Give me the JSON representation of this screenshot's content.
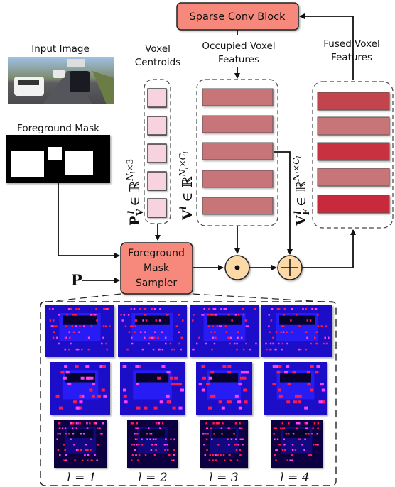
{
  "labels": {
    "input_image": "Input Image",
    "foreground_mask": "Foreground Mask",
    "voxel_centroids": [
      "Voxel",
      "Centroids"
    ],
    "occupied_voxel_features": [
      "Occupied Voxel",
      "Features"
    ],
    "fused_voxel_features": [
      "Fused Voxel",
      "Features"
    ],
    "sparse_conv_block": "Sparse Conv Block",
    "foreground_mask_sampler": [
      "Foreground",
      "Mask",
      "Sampler"
    ],
    "input_points": "P"
  },
  "math": {
    "centroids": {
      "symbol": "P",
      "sub": "V",
      "sup": "l",
      "rel": " ∈ ℝ",
      "dim": "N",
      "dim_sub": "l",
      "dim_rest": "×3"
    },
    "occupied": {
      "symbol": "V",
      "sup": "l",
      "rel": " ∈ ℝ",
      "dim": "N",
      "dim_sub": "l",
      "dim_rest": "×C",
      "dim_rest_sub": "l"
    },
    "fused": {
      "symbol": "V",
      "sub": "F",
      "sup": "l",
      "rel": " ∈ ℝ",
      "dim": "N",
      "dim_sub": "l",
      "dim_rest": "×C",
      "dim_rest_sub": "l"
    }
  },
  "operators": {
    "hadamard": "⊙",
    "add": "⊕"
  },
  "level_labels": [
    "l = 1",
    "l = 2",
    "l = 3",
    "l = 4"
  ],
  "colors": {
    "block_fill": "#f6897b",
    "operator_fill": "#fcd9a6",
    "centroid_fill": "#f7d3df",
    "occupied_fill": "#c8747a",
    "fused_fills": [
      "#c2444d",
      "#c8747a",
      "#c8333f",
      "#c8747a",
      "#c8293a"
    ]
  }
}
